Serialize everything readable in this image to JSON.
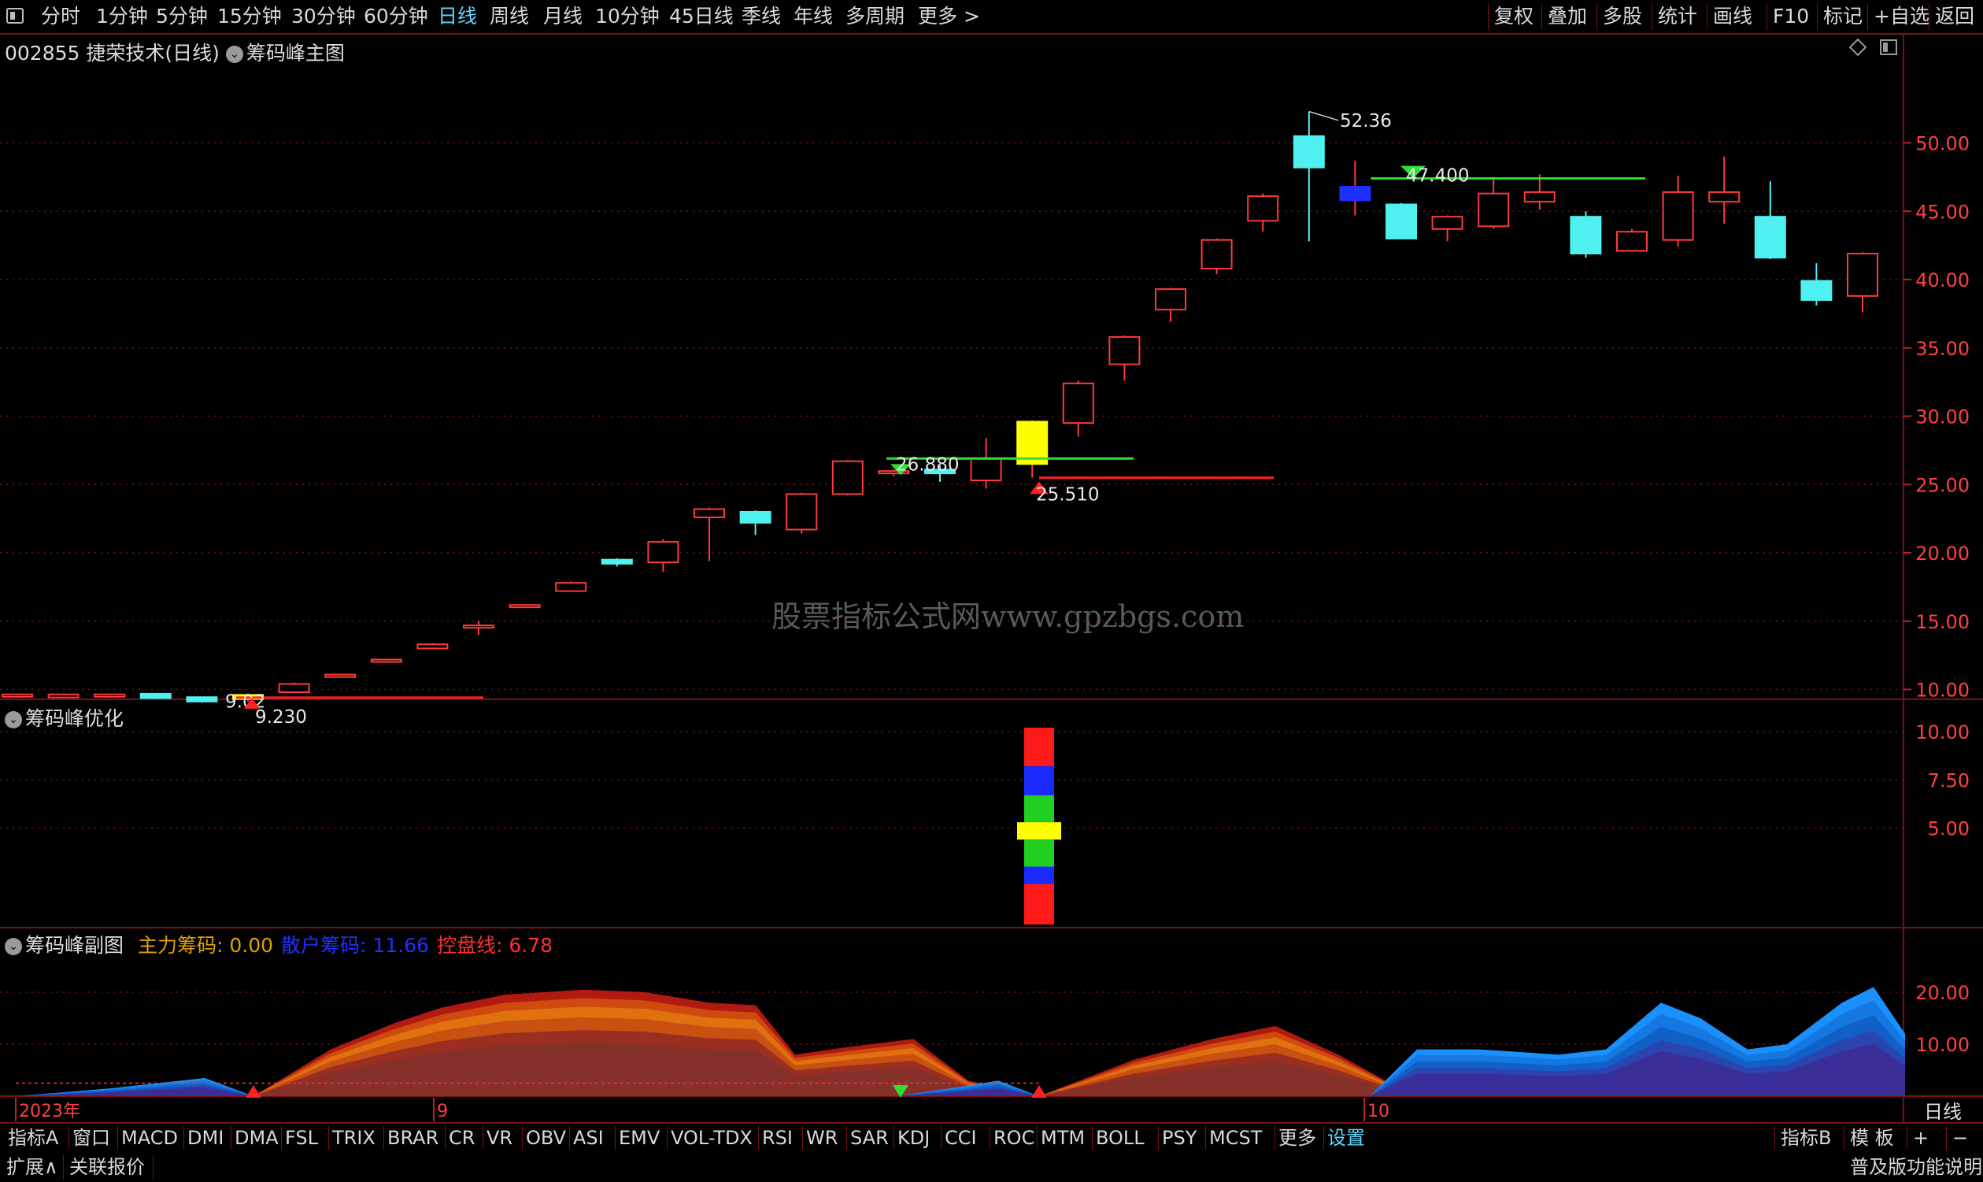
{
  "toolbar": {
    "periods": [
      "分时",
      "1分钟",
      "5分钟",
      "15分钟",
      "30分钟",
      "60分钟",
      "日线",
      "周线",
      "月线",
      "10分钟",
      "45日线",
      "季线",
      "年线",
      "多周期",
      "更多 >"
    ],
    "active_period": "日线",
    "right": [
      "复权",
      "叠加",
      "多股",
      "统计",
      "画线",
      "F10",
      "标记",
      "+自选",
      "返回"
    ]
  },
  "main_panel": {
    "stock_code": "002855",
    "stock_name": "捷荣技术(日线)",
    "indicator": "筹码峰主图",
    "y_ticks": [
      "50.00",
      "45.00",
      "40.00",
      "35.00",
      "30.00",
      "25.00",
      "20.00",
      "15.00",
      "10.00"
    ],
    "annotations": {
      "high": "52.36",
      "low": "9.02",
      "marker_47": "47.400",
      "marker_26": "26.880",
      "marker_25": "25.510",
      "marker_9": "9.230"
    }
  },
  "sub_panel1": {
    "title": "筹码峰优化",
    "y_ticks": [
      "10.00",
      "7.50",
      "5.00"
    ]
  },
  "sub_panel2": {
    "title": "筹码峰副图",
    "legend": [
      {
        "label": "主力筹码:",
        "value": "0.00",
        "color": "#e0a000"
      },
      {
        "label": "散户筹码:",
        "value": "11.66",
        "color": "#2030ff"
      },
      {
        "label": "控盘线:",
        "value": "6.78",
        "color": "#ff3030"
      }
    ],
    "y_ticks": [
      "20.00",
      "10.00"
    ]
  },
  "x_axis": {
    "labels": [
      "2023年",
      "9",
      "10"
    ],
    "period_label": "日线"
  },
  "indicator_bar": {
    "items": [
      "指标A",
      "窗口",
      "MACD",
      "DMI",
      "DMA",
      "FSL",
      "TRIX",
      "BRAR",
      "CR",
      "VR",
      "OBV",
      "ASI",
      "EMV",
      "VOL-TDX",
      "RSI",
      "WR",
      "SAR",
      "KDJ",
      "CCI",
      "ROC",
      "MTM",
      "BOLL",
      "PSY",
      "MCST",
      "更多",
      "设置"
    ],
    "active": "设置",
    "right": [
      "指标B",
      "模 板",
      "+",
      "−"
    ]
  },
  "footer": {
    "left": [
      "扩展∧",
      "关联报价"
    ],
    "right": "普及版功能说明"
  },
  "watermark": "股票指标公式网www.gpzbgs.com",
  "colors": {
    "up": "#ff3a3a",
    "down": "#4ff0f0",
    "grid": "#7a1010",
    "accent": "#5fd6ff"
  }
}
